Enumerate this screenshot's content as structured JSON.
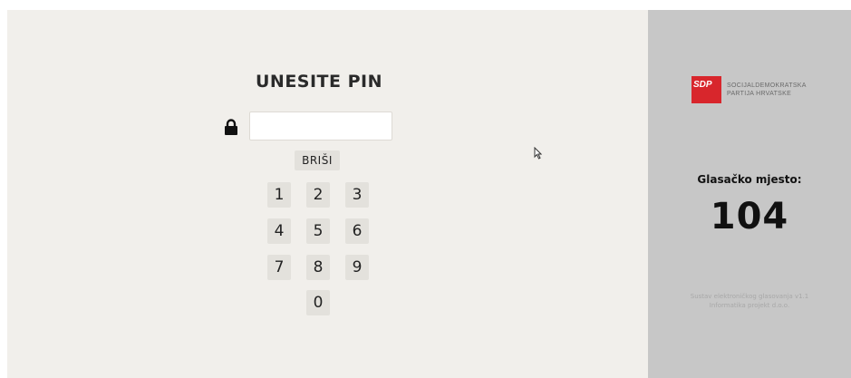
{
  "login": {
    "title": "UNESITE PIN",
    "pin_value": "",
    "clear_label": "BRIŠI"
  },
  "keypad": {
    "k1": "1",
    "k2": "2",
    "k3": "3",
    "k4": "4",
    "k5": "5",
    "k6": "6",
    "k7": "7",
    "k8": "8",
    "k9": "9",
    "k0": "0"
  },
  "sidebar": {
    "logo_mark": "SDP",
    "logo_line1": "SOCIJALDEMOKRATSKA",
    "logo_line2": "PARTIJA HRVATSKE",
    "station_label": "Glasačko mjesto:",
    "station_number": "104",
    "footer_line1": "Sustav elektroničkog glasovanja v1.1",
    "footer_line2": "Informatika projekt d.o.o."
  },
  "icons": {
    "lock": "lock-icon",
    "cursor": "mouse-pointer-icon"
  },
  "colors": {
    "background": "#f1efeb",
    "sidebar": "#c7c7c7",
    "key_button": "#e3e1dc",
    "logo_red": "#d8262c"
  }
}
